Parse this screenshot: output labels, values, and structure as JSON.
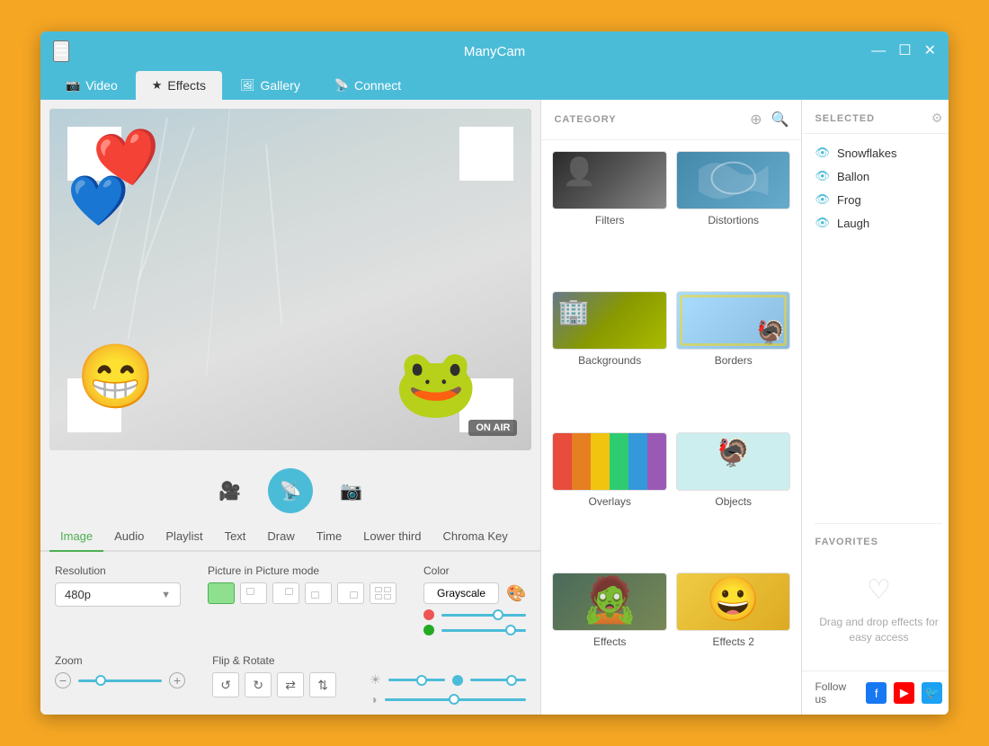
{
  "app": {
    "title": "ManyCam",
    "window_controls": {
      "minimize": "—",
      "maximize": "☐",
      "close": "✕"
    }
  },
  "nav": {
    "tabs": [
      {
        "id": "video",
        "icon": "📷",
        "label": "Video",
        "active": false
      },
      {
        "id": "effects",
        "icon": "★",
        "label": "Effects",
        "active": true
      },
      {
        "id": "gallery",
        "icon": "🖼",
        "label": "Gallery",
        "active": false
      },
      {
        "id": "connect",
        "icon": "📡",
        "label": "Connect",
        "active": false
      }
    ]
  },
  "category_panel": {
    "title": "CATEGORY",
    "add_btn": "+",
    "search_btn": "🔍",
    "items": [
      {
        "id": "filters",
        "label": "Filters"
      },
      {
        "id": "distortions",
        "label": "Distortions"
      },
      {
        "id": "backgrounds",
        "label": "Backgrounds"
      },
      {
        "id": "borders",
        "label": "Borders"
      },
      {
        "id": "overlays",
        "label": "Overlays"
      },
      {
        "id": "objects",
        "label": "Objects"
      },
      {
        "id": "effects1",
        "label": "Effects"
      },
      {
        "id": "effects2",
        "label": "Effects 2"
      }
    ]
  },
  "selected_panel": {
    "title": "SELECTED",
    "items": [
      {
        "id": "snowflakes",
        "label": "Snowflakes"
      },
      {
        "id": "ballon",
        "label": "Ballon"
      },
      {
        "id": "frog",
        "label": "Frog"
      },
      {
        "id": "laugh",
        "label": "Laugh"
      }
    ]
  },
  "favorites_panel": {
    "title": "FAVORITES",
    "hint": "Drag and drop effects for easy access"
  },
  "follow": {
    "label": "Follow us"
  },
  "controls": {
    "on_air_label": "ON AIR"
  },
  "image_tabs": {
    "tabs": [
      {
        "id": "image",
        "label": "Image",
        "active": true
      },
      {
        "id": "audio",
        "label": "Audio",
        "active": false
      },
      {
        "id": "playlist",
        "label": "Playlist",
        "active": false
      },
      {
        "id": "text",
        "label": "Text",
        "active": false
      },
      {
        "id": "draw",
        "label": "Draw",
        "active": false
      },
      {
        "id": "time",
        "label": "Time",
        "active": false
      },
      {
        "id": "lowerthird",
        "label": "Lower third",
        "active": false
      },
      {
        "id": "chromakey",
        "label": "Chroma Key",
        "active": false
      }
    ]
  },
  "settings": {
    "resolution_label": "Resolution",
    "resolution_value": "480p",
    "pip_label": "Picture in Picture mode",
    "color_label": "Color",
    "color_value": "Grayscale",
    "zoom_label": "Zoom",
    "flip_label": "Flip & Rotate",
    "flip_btns": [
      "↺",
      "↻",
      "⇄",
      "⇅"
    ]
  }
}
